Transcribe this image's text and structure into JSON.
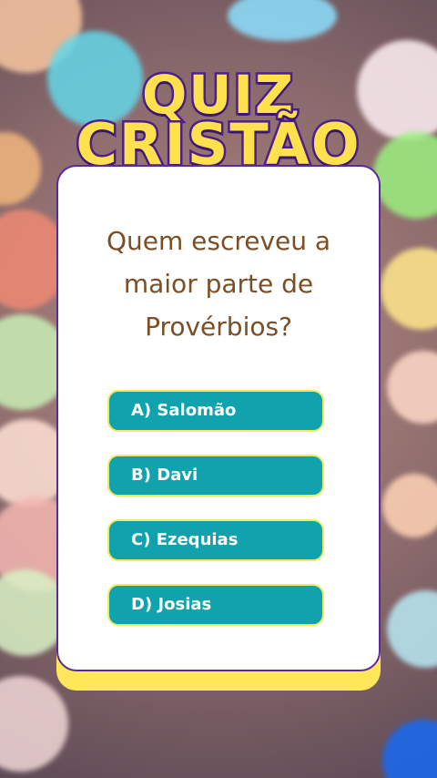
{
  "title": {
    "line1": "QUIZ",
    "line2": "CRISTÃO"
  },
  "question": {
    "text": "Quem escreveu a maior parte de Provérbios?"
  },
  "options": [
    {
      "label": "A) Salomão"
    },
    {
      "label": "B) Davi"
    },
    {
      "label": "C) Ezequias"
    },
    {
      "label": "D) Josias"
    }
  ],
  "colors": {
    "title_fill": "#ffe14d",
    "title_outline": "#4b1f8f",
    "card_border": "#5b2a9c",
    "card_shadow": "#ffe65a",
    "question_text": "#7a4f25",
    "option_bg": "#11a3ad",
    "option_border": "#f2ea5b",
    "option_text": "#ffffff"
  }
}
